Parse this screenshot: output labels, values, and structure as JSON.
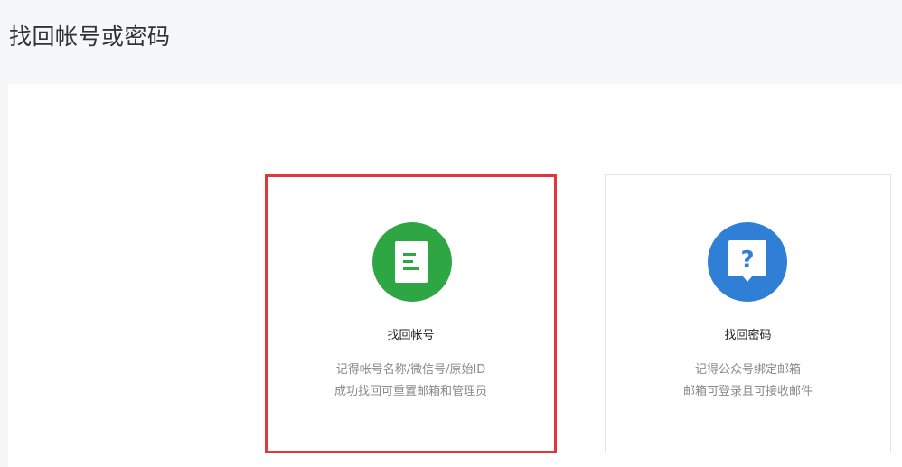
{
  "page": {
    "title": "找回帐号或密码"
  },
  "options": [
    {
      "title": "找回帐号",
      "desc_line1": "记得帐号名称/微信号/原始ID",
      "desc_line2": "成功找回可重置邮箱和管理员",
      "icon": "document-icon",
      "icon_color": "#2ea643",
      "selected": true,
      "highlight_color": "#e0373b"
    },
    {
      "title": "找回密码",
      "desc_line1": "记得公众号绑定邮箱",
      "desc_line2": "邮箱可登录且可接收邮件",
      "icon": "question-icon",
      "icon_color": "#2f7fd6",
      "selected": false
    }
  ]
}
